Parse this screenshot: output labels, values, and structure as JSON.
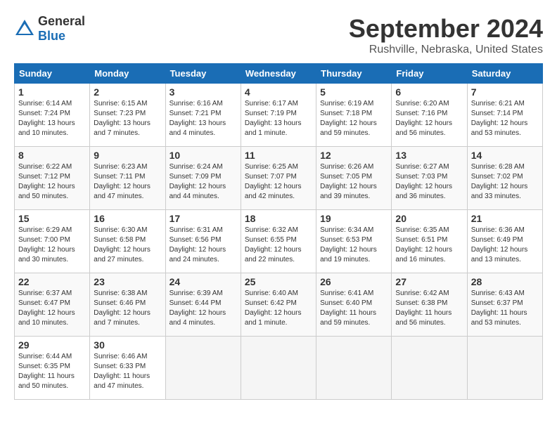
{
  "logo": {
    "general": "General",
    "blue": "Blue"
  },
  "title": "September 2024",
  "location": "Rushville, Nebraska, United States",
  "days_of_week": [
    "Sunday",
    "Monday",
    "Tuesday",
    "Wednesday",
    "Thursday",
    "Friday",
    "Saturday"
  ],
  "weeks": [
    [
      {
        "num": "1",
        "info": "Sunrise: 6:14 AM\nSunset: 7:24 PM\nDaylight: 13 hours\nand 10 minutes."
      },
      {
        "num": "2",
        "info": "Sunrise: 6:15 AM\nSunset: 7:23 PM\nDaylight: 13 hours\nand 7 minutes."
      },
      {
        "num": "3",
        "info": "Sunrise: 6:16 AM\nSunset: 7:21 PM\nDaylight: 13 hours\nand 4 minutes."
      },
      {
        "num": "4",
        "info": "Sunrise: 6:17 AM\nSunset: 7:19 PM\nDaylight: 13 hours\nand 1 minute."
      },
      {
        "num": "5",
        "info": "Sunrise: 6:19 AM\nSunset: 7:18 PM\nDaylight: 12 hours\nand 59 minutes."
      },
      {
        "num": "6",
        "info": "Sunrise: 6:20 AM\nSunset: 7:16 PM\nDaylight: 12 hours\nand 56 minutes."
      },
      {
        "num": "7",
        "info": "Sunrise: 6:21 AM\nSunset: 7:14 PM\nDaylight: 12 hours\nand 53 minutes."
      }
    ],
    [
      {
        "num": "8",
        "info": "Sunrise: 6:22 AM\nSunset: 7:12 PM\nDaylight: 12 hours\nand 50 minutes."
      },
      {
        "num": "9",
        "info": "Sunrise: 6:23 AM\nSunset: 7:11 PM\nDaylight: 12 hours\nand 47 minutes."
      },
      {
        "num": "10",
        "info": "Sunrise: 6:24 AM\nSunset: 7:09 PM\nDaylight: 12 hours\nand 44 minutes."
      },
      {
        "num": "11",
        "info": "Sunrise: 6:25 AM\nSunset: 7:07 PM\nDaylight: 12 hours\nand 42 minutes."
      },
      {
        "num": "12",
        "info": "Sunrise: 6:26 AM\nSunset: 7:05 PM\nDaylight: 12 hours\nand 39 minutes."
      },
      {
        "num": "13",
        "info": "Sunrise: 6:27 AM\nSunset: 7:03 PM\nDaylight: 12 hours\nand 36 minutes."
      },
      {
        "num": "14",
        "info": "Sunrise: 6:28 AM\nSunset: 7:02 PM\nDaylight: 12 hours\nand 33 minutes."
      }
    ],
    [
      {
        "num": "15",
        "info": "Sunrise: 6:29 AM\nSunset: 7:00 PM\nDaylight: 12 hours\nand 30 minutes."
      },
      {
        "num": "16",
        "info": "Sunrise: 6:30 AM\nSunset: 6:58 PM\nDaylight: 12 hours\nand 27 minutes."
      },
      {
        "num": "17",
        "info": "Sunrise: 6:31 AM\nSunset: 6:56 PM\nDaylight: 12 hours\nand 24 minutes."
      },
      {
        "num": "18",
        "info": "Sunrise: 6:32 AM\nSunset: 6:55 PM\nDaylight: 12 hours\nand 22 minutes."
      },
      {
        "num": "19",
        "info": "Sunrise: 6:34 AM\nSunset: 6:53 PM\nDaylight: 12 hours\nand 19 minutes."
      },
      {
        "num": "20",
        "info": "Sunrise: 6:35 AM\nSunset: 6:51 PM\nDaylight: 12 hours\nand 16 minutes."
      },
      {
        "num": "21",
        "info": "Sunrise: 6:36 AM\nSunset: 6:49 PM\nDaylight: 12 hours\nand 13 minutes."
      }
    ],
    [
      {
        "num": "22",
        "info": "Sunrise: 6:37 AM\nSunset: 6:47 PM\nDaylight: 12 hours\nand 10 minutes."
      },
      {
        "num": "23",
        "info": "Sunrise: 6:38 AM\nSunset: 6:46 PM\nDaylight: 12 hours\nand 7 minutes."
      },
      {
        "num": "24",
        "info": "Sunrise: 6:39 AM\nSunset: 6:44 PM\nDaylight: 12 hours\nand 4 minutes."
      },
      {
        "num": "25",
        "info": "Sunrise: 6:40 AM\nSunset: 6:42 PM\nDaylight: 12 hours\nand 1 minute."
      },
      {
        "num": "26",
        "info": "Sunrise: 6:41 AM\nSunset: 6:40 PM\nDaylight: 11 hours\nand 59 minutes."
      },
      {
        "num": "27",
        "info": "Sunrise: 6:42 AM\nSunset: 6:38 PM\nDaylight: 11 hours\nand 56 minutes."
      },
      {
        "num": "28",
        "info": "Sunrise: 6:43 AM\nSunset: 6:37 PM\nDaylight: 11 hours\nand 53 minutes."
      }
    ],
    [
      {
        "num": "29",
        "info": "Sunrise: 6:44 AM\nSunset: 6:35 PM\nDaylight: 11 hours\nand 50 minutes."
      },
      {
        "num": "30",
        "info": "Sunrise: 6:46 AM\nSunset: 6:33 PM\nDaylight: 11 hours\nand 47 minutes."
      },
      null,
      null,
      null,
      null,
      null
    ]
  ]
}
